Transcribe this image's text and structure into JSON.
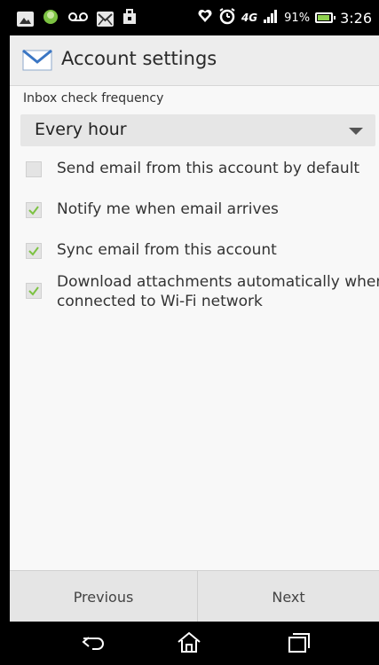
{
  "status_bar": {
    "battery_percent": "91%",
    "time": "3:26",
    "network": "4G",
    "icons_left": [
      "gallery-icon",
      "android-icon",
      "voicemail-icon",
      "email-notification-icon",
      "shopping-bag-icon"
    ],
    "icons_right": [
      "heart-shield-icon",
      "alarm-icon",
      "network-icon",
      "signal-icon",
      "battery-icon"
    ]
  },
  "app_bar": {
    "icon": "mail-envelope-icon",
    "title": "Account settings"
  },
  "settings": {
    "frequency_label": "Inbox check frequency",
    "frequency_value": "Every hour",
    "options": [
      {
        "label": "Send email from this account by default",
        "checked": false
      },
      {
        "label": "Notify me when email arrives",
        "checked": true
      },
      {
        "label": "Sync email from this account",
        "checked": true
      },
      {
        "label_line1": "Download attachments automatically when",
        "label_line2": "connected to Wi-Fi network",
        "checked": true
      }
    ]
  },
  "buttons": {
    "previous": "Previous",
    "next": "Next"
  },
  "nav_bar": {
    "icons": [
      "back-icon",
      "home-icon",
      "recent-apps-icon"
    ]
  },
  "colors": {
    "check_color": "#7cc242",
    "app_bar_bg": "#ededed",
    "content_bg": "#f8f8f8"
  }
}
